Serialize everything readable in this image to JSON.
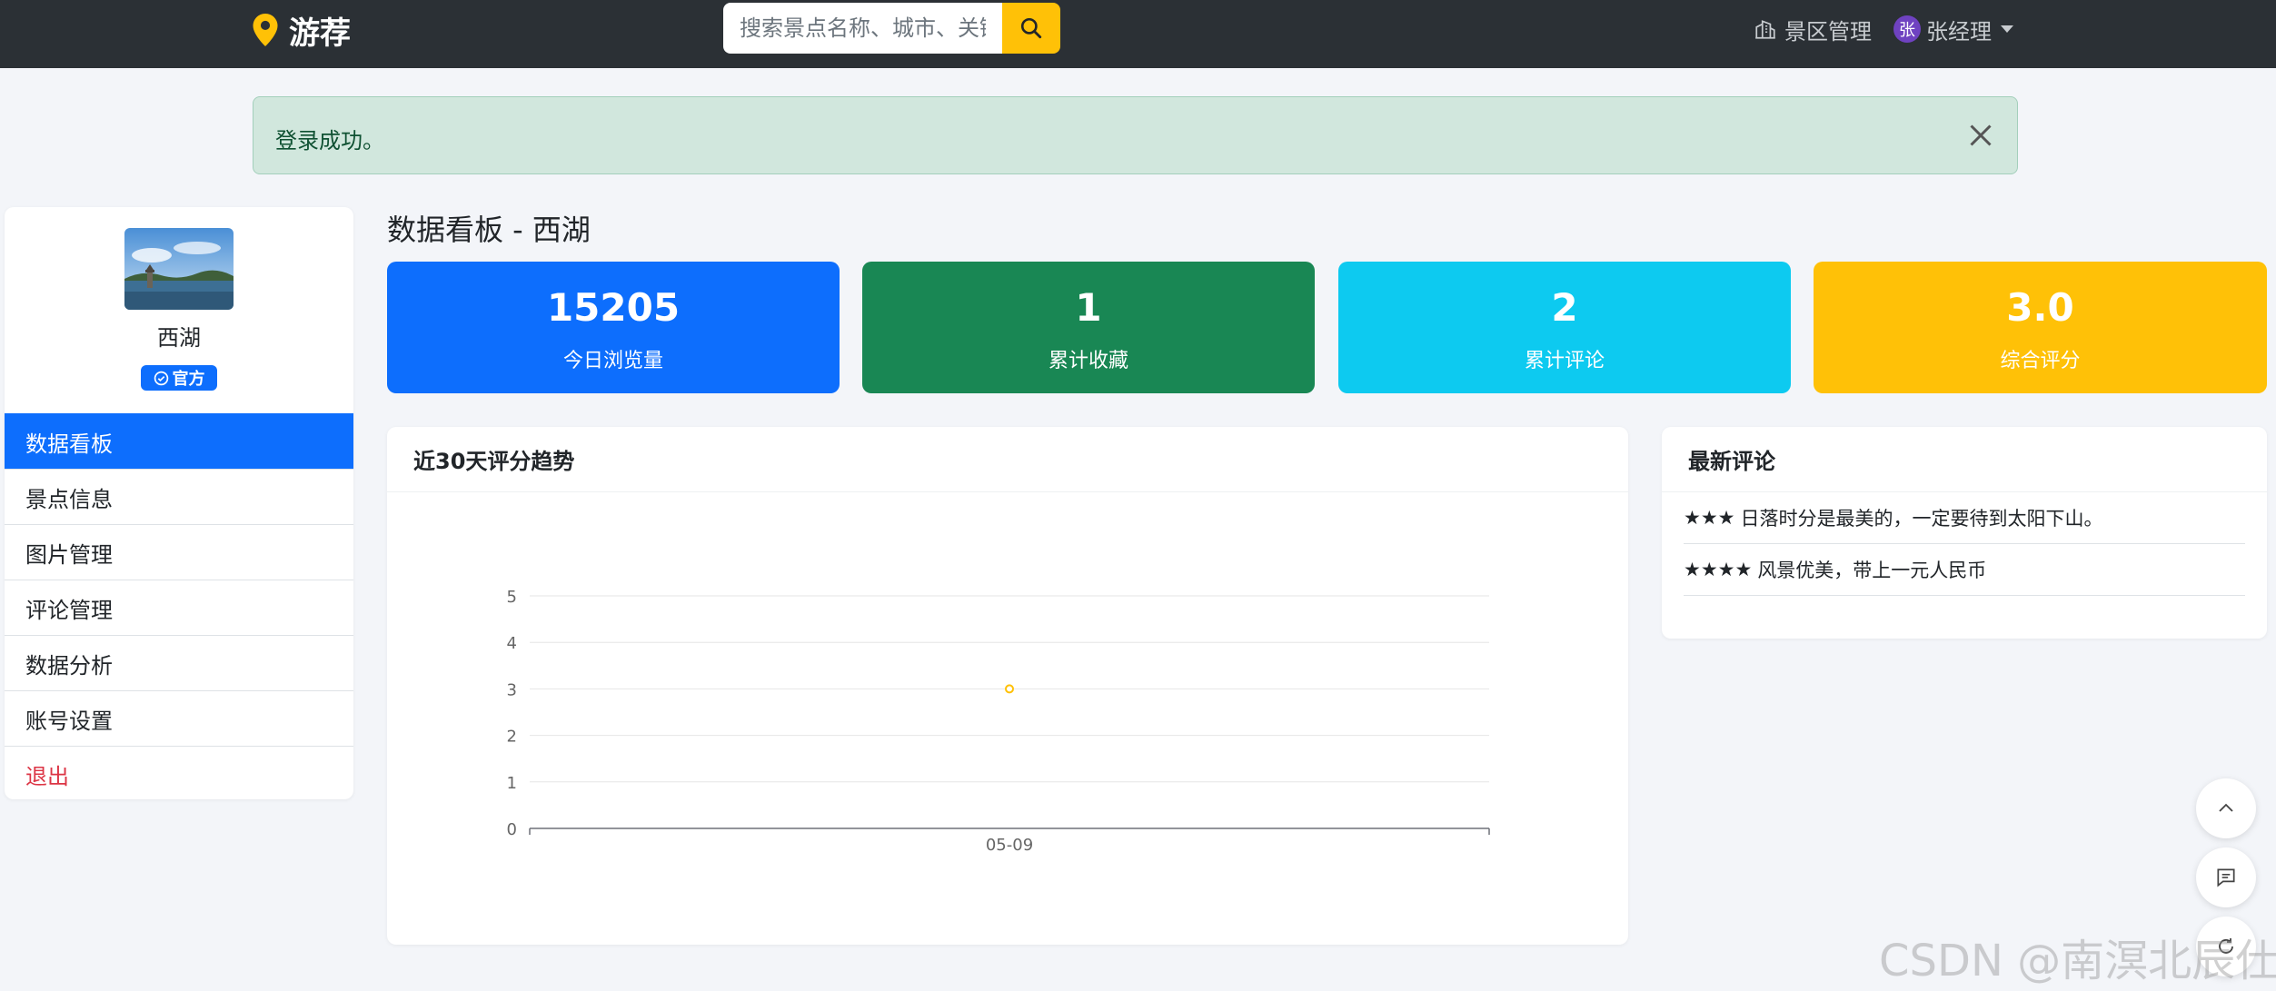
{
  "navbar": {
    "brand": "游荐",
    "search_placeholder": "搜索景点名称、城市、关键词",
    "manage_link": "景区管理",
    "user_avatar_char": "张",
    "user_name": "张经理"
  },
  "alert": {
    "message": "登录成功。"
  },
  "sidebar": {
    "spot_name": "西湖",
    "badge": "官方",
    "menu": [
      {
        "label": "数据看板",
        "active": true
      },
      {
        "label": "景点信息"
      },
      {
        "label": "图片管理"
      },
      {
        "label": "评论管理"
      },
      {
        "label": "数据分析"
      },
      {
        "label": "账号设置"
      },
      {
        "label": "退出",
        "danger": true
      }
    ]
  },
  "main": {
    "title": "数据看板 - 西湖",
    "stats": [
      {
        "value": "15205",
        "label": "今日浏览量",
        "color": "#0d6efd"
      },
      {
        "value": "1",
        "label": "累计收藏",
        "color": "#198754"
      },
      {
        "value": "2",
        "label": "累计评论",
        "color": "#0dcaf0"
      },
      {
        "value": "3.0",
        "label": "综合评分",
        "color": "#ffc107"
      }
    ],
    "trend_title": "近30天评分趋势",
    "reviews_title": "最新评论",
    "reviews": [
      {
        "stars": "★★★",
        "text": "日落时分是最美的，一定要待到太阳下山。"
      },
      {
        "stars": "★★★★",
        "text": "风景优美，带上一元人民币"
      }
    ]
  },
  "chart_data": {
    "type": "line",
    "title": "",
    "xlabel": "",
    "ylabel": "",
    "categories": [
      "05-09"
    ],
    "series": [
      {
        "values": [
          3
        ]
      }
    ],
    "ylim": [
      0,
      5
    ],
    "yticks": [
      "0",
      "1",
      "2",
      "3",
      "4",
      "5"
    ],
    "grid": true,
    "line_color": "#ffc107"
  },
  "watermark": "CSDN @南溟北辰仕"
}
